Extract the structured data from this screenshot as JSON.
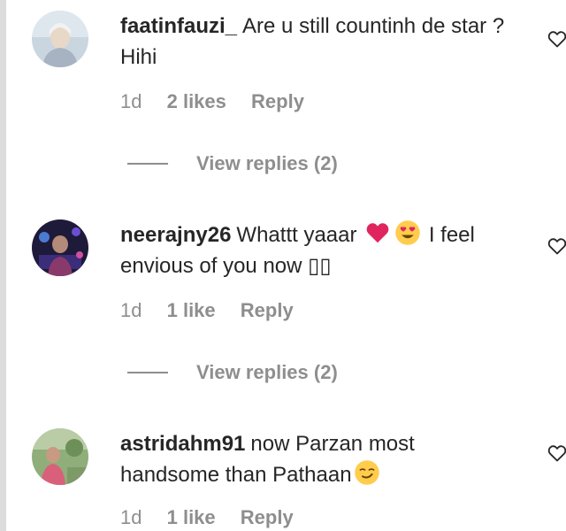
{
  "comments": [
    {
      "username": "faatinfauzi_",
      "text": "Are u still countinh de star ? Hihi",
      "time": "1d",
      "likes": "2 likes",
      "reply": "Reply",
      "view_replies": "View replies (2)",
      "avatar_icon": "user-avatar-1"
    },
    {
      "username": "neerajny26",
      "text_before": "Whattt yaaar",
      "text_after": "I feel envious of you now ▯▯",
      "emojis": [
        "red-heart-emoji",
        "heart-eyes-emoji"
      ],
      "time": "1d",
      "likes": "1 like",
      "reply": "Reply",
      "view_replies": "View replies (2)",
      "avatar_icon": "user-avatar-2"
    },
    {
      "username": "astridahm91",
      "text": "now Parzan most handsome than Pathaan",
      "emojis": [
        "smirk-emoji"
      ],
      "time": "1d",
      "likes": "1 like",
      "reply": "Reply",
      "avatar_icon": "user-avatar-3"
    }
  ],
  "icons": {
    "like": "heart-outline-icon"
  },
  "colors": {
    "text": "#262626",
    "muted": "#8e8e8e",
    "heart_red": "#e0245e"
  }
}
